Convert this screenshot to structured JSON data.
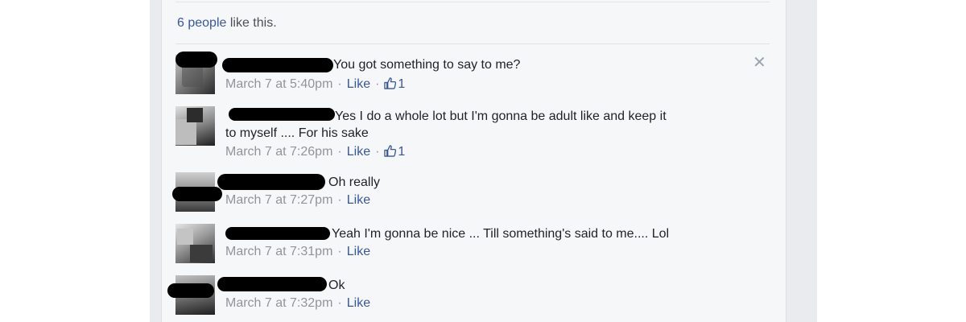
{
  "likes": {
    "count_text": "6 people",
    "suffix_text": "like this."
  },
  "comments": [
    {
      "text": "You got something to say to me?",
      "timestamp": "March 7 at 5:40pm",
      "like_label": "Like",
      "like_count": "1"
    },
    {
      "text_line1": "Yes I do a whole lot but I'm gonna be adult like and keep it",
      "text_line2": "to myself .... For his sake",
      "timestamp": "March 7 at 7:26pm",
      "like_label": "Like",
      "like_count": "1"
    },
    {
      "text": "Oh really",
      "timestamp": "March 7 at 7:27pm",
      "like_label": "Like"
    },
    {
      "text": "Yeah I'm gonna be nice ... Till something's said to me.... Lol",
      "timestamp": "March 7 at 7:31pm",
      "like_label": "Like"
    },
    {
      "text": "Ok",
      "timestamp": "March 7 at 7:32pm",
      "like_label": "Like"
    }
  ],
  "icons": {
    "close": "close-icon",
    "thumbs_up": "thumbs-up-icon"
  },
  "colors": {
    "link": "#385898",
    "meta": "#90949c",
    "text": "#1d2129"
  }
}
